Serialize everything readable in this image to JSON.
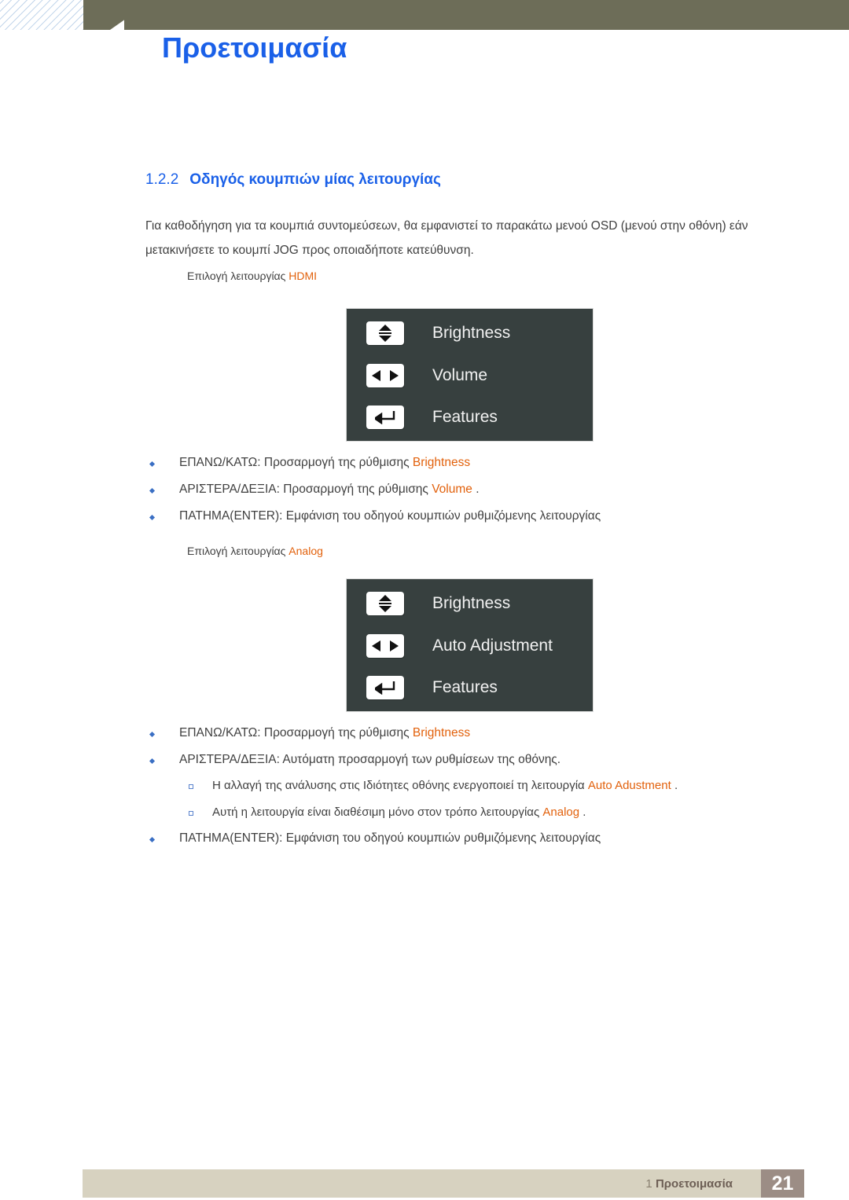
{
  "header": {
    "chapter_number": "1",
    "title": "Προετοιμασία"
  },
  "section": {
    "number": "1.2.2",
    "title": "Οδηγός κουμπιών μίας λειτουργίας",
    "intro": "Για καθοδήγηση για τα κουμπιά συντομεύσεων, θα εμφανιστεί το παρακάτω μενού OSD (μενού στην οθόνη) εάν μετακινήσετε το κουμπί JOG προς οποιαδήποτε κατεύθυνση."
  },
  "hdmi_block": {
    "label_prefix": "Επιλογή λειτουργίας ",
    "label_mode": "HDMI",
    "osd": {
      "rows": [
        {
          "icon": "up-down-arrows-icon",
          "label": "Brightness"
        },
        {
          "icon": "left-right-arrows-icon",
          "label": "Volume"
        },
        {
          "icon": "enter-return-arrow-icon",
          "label": "Features"
        }
      ]
    },
    "bullets": [
      {
        "pre": "ΕΠΑΝΩ/ΚΑΤΩ: Προσαρμογή της ρύθμισης ",
        "hl": "Brightness",
        "post": ""
      },
      {
        "pre": "ΑΡΙΣΤΕΡΑ/ΔΕΞΙΑ: Προσαρμογή της ρύθμισης ",
        "hl": "Volume",
        "post": " ."
      },
      {
        "pre": "ΠΑΤΗΜΑ(ENTER): Εμφάνιση του οδηγού κουμπιών ρυθμιζόμενης λειτουργίας",
        "hl": "",
        "post": ""
      }
    ]
  },
  "analog_block": {
    "label_prefix": "Επιλογή λειτουργίας ",
    "label_mode": "Analog",
    "osd": {
      "rows": [
        {
          "icon": "up-down-arrows-icon",
          "label": "Brightness"
        },
        {
          "icon": "left-right-arrows-icon",
          "label": "Auto Adjustment"
        },
        {
          "icon": "enter-return-arrow-icon",
          "label": "Features"
        }
      ]
    },
    "bullets": [
      {
        "pre": "ΕΠΑΝΩ/ΚΑΤΩ: Προσαρμογή της ρύθμισης ",
        "hl": "Brightness",
        "post": ""
      },
      {
        "pre": "ΑΡΙΣΤΕΡΑ/ΔΕΞΙΑ: Αυτόματη προσαρμογή των ρυθμίσεων της οθόνης.",
        "hl": "",
        "post": ""
      }
    ],
    "subbullets": [
      {
        "pre": "Η αλλαγή της ανάλυσης στις Ιδιότητες οθόνης ενεργοποιεί τη λειτουργία ",
        "hl": "Auto Adustment",
        "post": "  ."
      },
      {
        "pre": "Αυτή η λειτουργία είναι διαθέσιμη μόνο στον τρόπο λειτουργίας ",
        "hl": "Analog",
        "post": " ."
      }
    ],
    "final_bullet": {
      "pre": "ΠΑΤΗΜΑ(ENTER): Εμφάνιση του οδηγού κουμπιών ρυθμιζόμενης λειτουργίας",
      "hl": "",
      "post": ""
    }
  },
  "footer": {
    "chapter": "1",
    "chapter_name": "Προετοιμασία",
    "page_number": "21"
  },
  "colors": {
    "heading_blue": "#1a60e8",
    "highlight_orange": "#e2610c",
    "header_olive": "#6d6d58",
    "osd_background": "#37403f",
    "footer_beige": "#d7d2c0",
    "footer_page_taupe": "#9c8d85",
    "bullet_blue": "#3a6fc4"
  }
}
